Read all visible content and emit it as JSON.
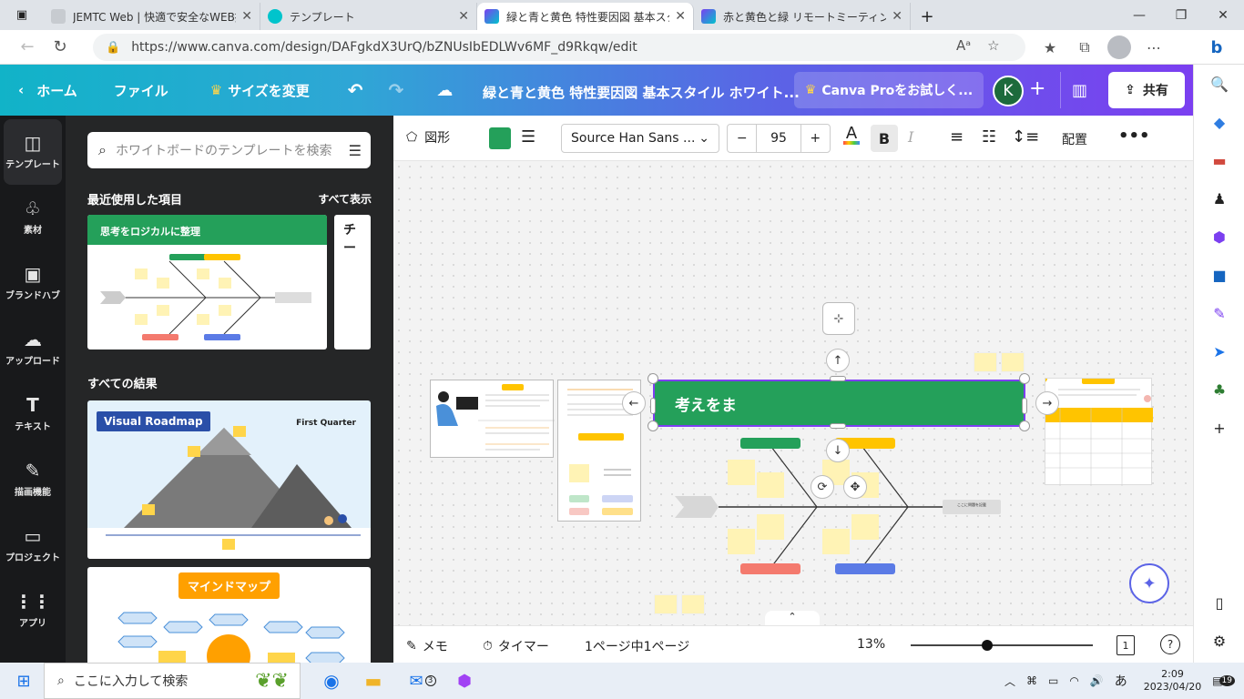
{
  "browser": {
    "tabs": [
      {
        "title": "JEMTC Web | 快適で安全なWEB授業",
        "active": false
      },
      {
        "title": "テンプレート",
        "active": false
      },
      {
        "title": "緑と青と黄色 特性要因図 基本スタイル",
        "active": true
      },
      {
        "title": "赤と黄色と緑 リモートミーティング 基本",
        "active": false
      }
    ],
    "url": "https://www.canva.com/design/DAFgkdX3UrQ/bZNUsIbEDLWv6MF_d9Rkqw/edit"
  },
  "topbar": {
    "home": "ホーム",
    "file": "ファイル",
    "resize": "サイズを変更",
    "doc_title": "緑と青と黄色 特性要因図 基本スタイル ホワイト...",
    "try_pro": "Canva Proをお試しく...",
    "avatar": "K",
    "share": "共有"
  },
  "leftrail": {
    "items": [
      {
        "label": "テンプレート",
        "icon": "template-icon"
      },
      {
        "label": "素材",
        "icon": "elements-icon"
      },
      {
        "label": "ブランドハブ",
        "icon": "brand-icon"
      },
      {
        "label": "アップロード",
        "icon": "upload-icon"
      },
      {
        "label": "テキスト",
        "icon": "text-icon"
      },
      {
        "label": "描画機能",
        "icon": "draw-icon"
      },
      {
        "label": "プロジェクト",
        "icon": "folder-icon"
      },
      {
        "label": "アプリ",
        "icon": "apps-icon"
      }
    ]
  },
  "panel": {
    "search_placeholder": "ホワイトボードのテンプレートを検索",
    "recent_heading": "最近使用した項目",
    "show_all": "すべて表示",
    "recent1_title": "思考をロジカルに整理",
    "recent2_title": "チー",
    "results_heading": "すべての結果",
    "result1_title": "Visual Roadmap",
    "result1_sub": "First Quarter",
    "result2_title": "マインドマップ"
  },
  "editbar": {
    "shape": "図形",
    "font": "Source Han Sans ...",
    "font_size": "95",
    "arrange": "配置"
  },
  "canvas": {
    "selected_text": "考えをま",
    "fish_head": "ここに問題を記載"
  },
  "bottombar": {
    "notes": "メモ",
    "timer": "タイマー",
    "pages": "1ページ中1ページ",
    "zoom": "13%",
    "page_num": "1"
  },
  "taskbar": {
    "search": "ここに入力して検索",
    "mail_badge": "3",
    "time": "2:09",
    "date": "2023/04/20",
    "notif": "19",
    "ime": "あ"
  },
  "colors": {
    "accent_green": "#24a05a",
    "selection": "#7d3ff0",
    "yellow": "#ffc400"
  }
}
